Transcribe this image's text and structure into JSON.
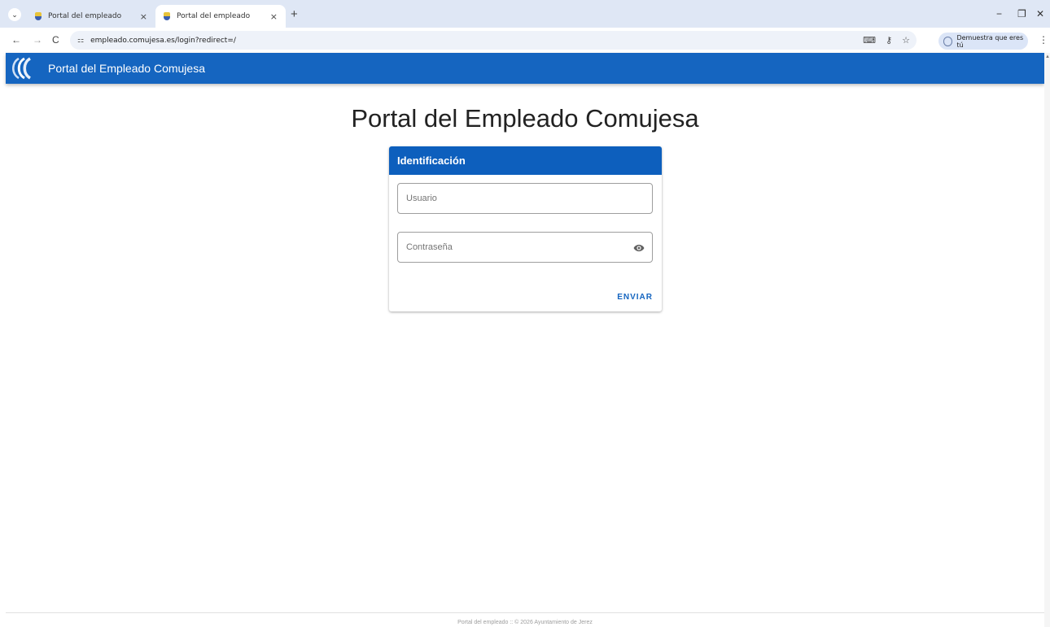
{
  "browser": {
    "tabs": [
      {
        "title": "Portal del empleado",
        "active": false
      },
      {
        "title": "Portal del empleado",
        "active": true
      }
    ],
    "tab_close": "×",
    "new_tab": "+",
    "url": "empleado.comujesa.es/login?redirect=/",
    "profile_label": "Demuestra que eres tú",
    "window_controls": {
      "minimize": "−",
      "restore": "❐",
      "close": "✕"
    },
    "nav": {
      "back": "←",
      "forward": "→",
      "reload": "C"
    },
    "icons": [
      "translate-icon",
      "key-icon",
      "star-icon",
      "extensions-icon",
      "menu-icon"
    ]
  },
  "app": {
    "header_title": "Portal del Empleado Comujesa",
    "brand_color": "#1565c0"
  },
  "page": {
    "title": "Portal del Empleado Comujesa"
  },
  "login": {
    "card_title": "Identificación",
    "username_placeholder": "Usuario",
    "password_placeholder": "Contraseña",
    "submit_label": "ENVIAR"
  },
  "footer": {
    "text": "Portal del empleado :: © 2026 Ayuntamiento de Jerez"
  }
}
